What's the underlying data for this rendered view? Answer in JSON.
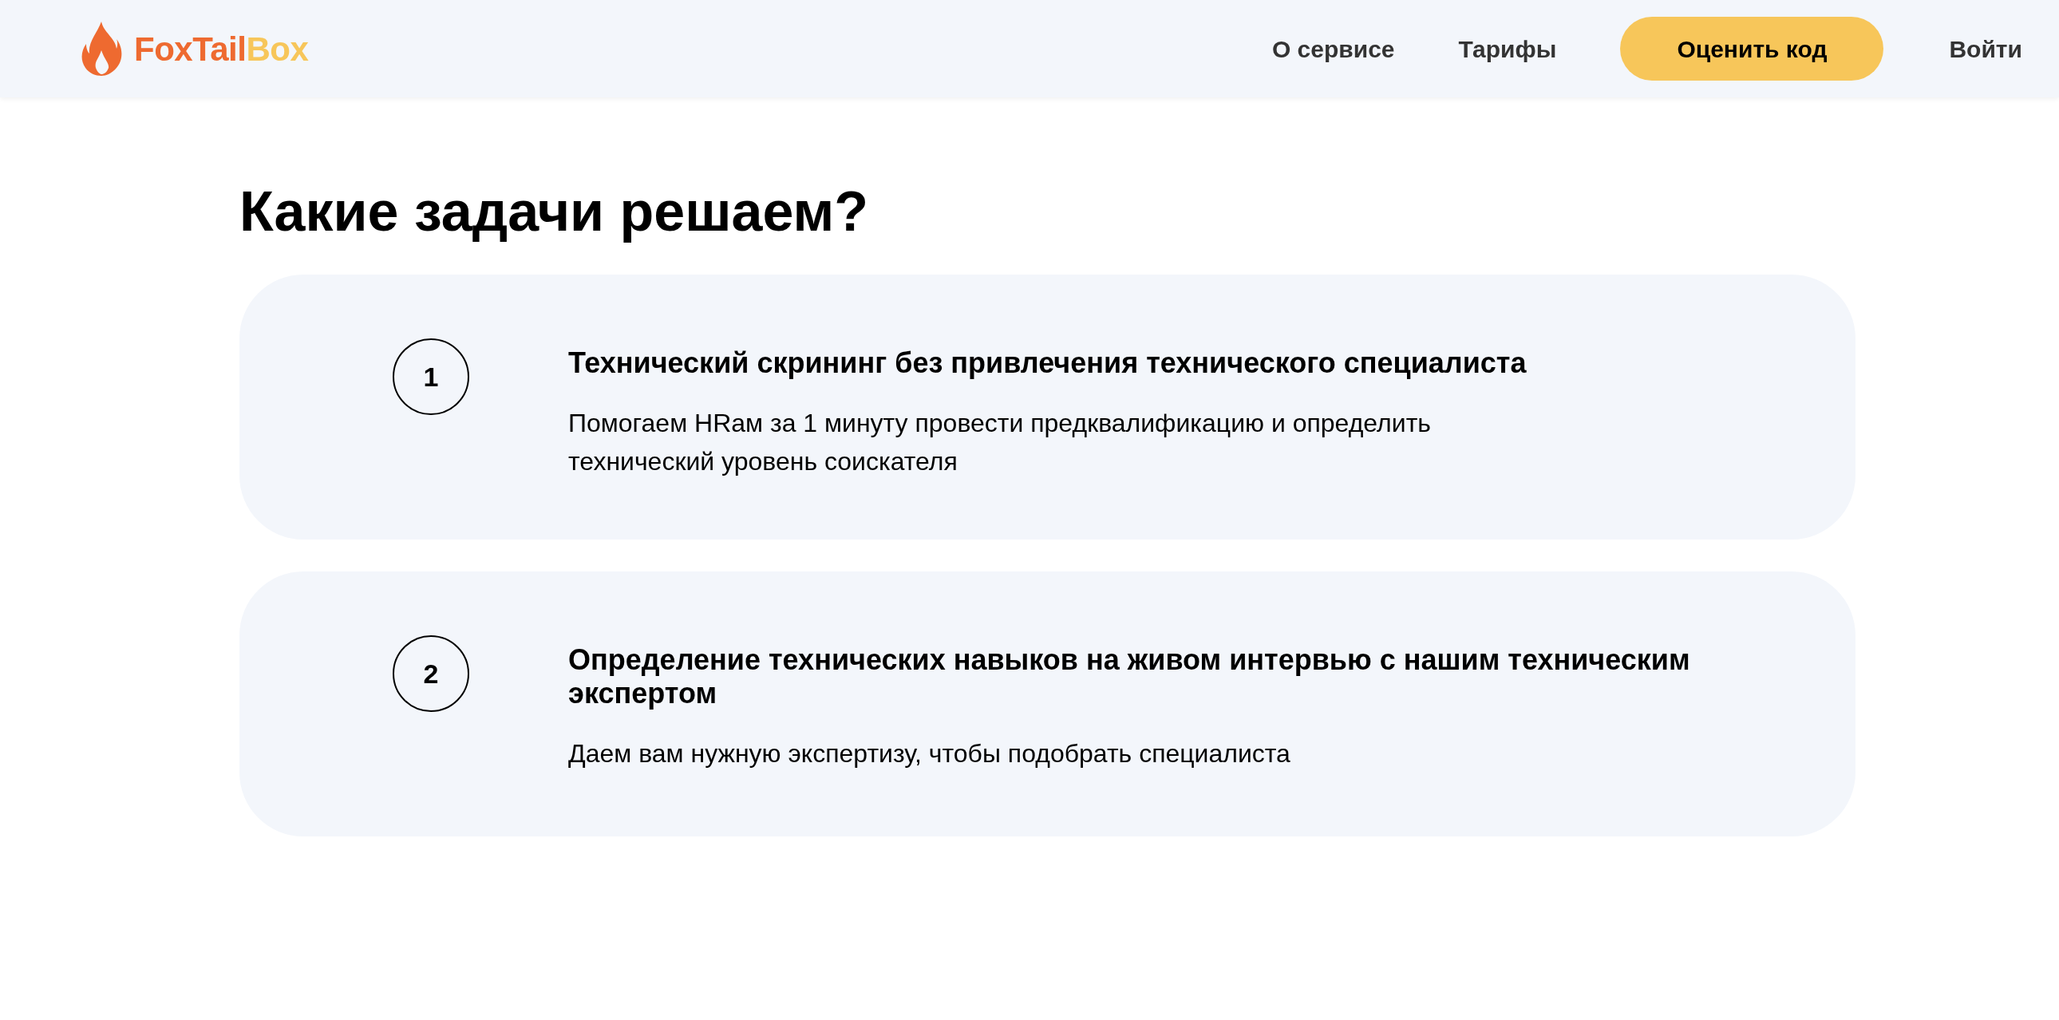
{
  "header": {
    "logo": {
      "parts": [
        {
          "text": "FoxTail",
          "color": "#ee6a30"
        },
        {
          "text": "Box",
          "color": "#f7c65a"
        }
      ]
    },
    "nav": [
      {
        "kind": "link",
        "label": "О сервисе"
      },
      {
        "kind": "link",
        "label": "Тарифы"
      },
      {
        "kind": "cta",
        "label": "Оценить код"
      },
      {
        "kind": "link",
        "label": "Войти"
      }
    ]
  },
  "section": {
    "title": "Какие задачи решаем?",
    "tasks": [
      {
        "number": "1",
        "title": "Технический скрининг без привлечения технического специалиста",
        "description": "Помогаем HRам за 1 минуту провести предквалификацию и определить технический уровень соискателя"
      },
      {
        "number": "2",
        "title": "Определение технических навыков на живом интервью с нашим техническим экспертом",
        "description": "Даем вам нужную экспертизу, чтобы подобрать специалиста"
      }
    ]
  }
}
